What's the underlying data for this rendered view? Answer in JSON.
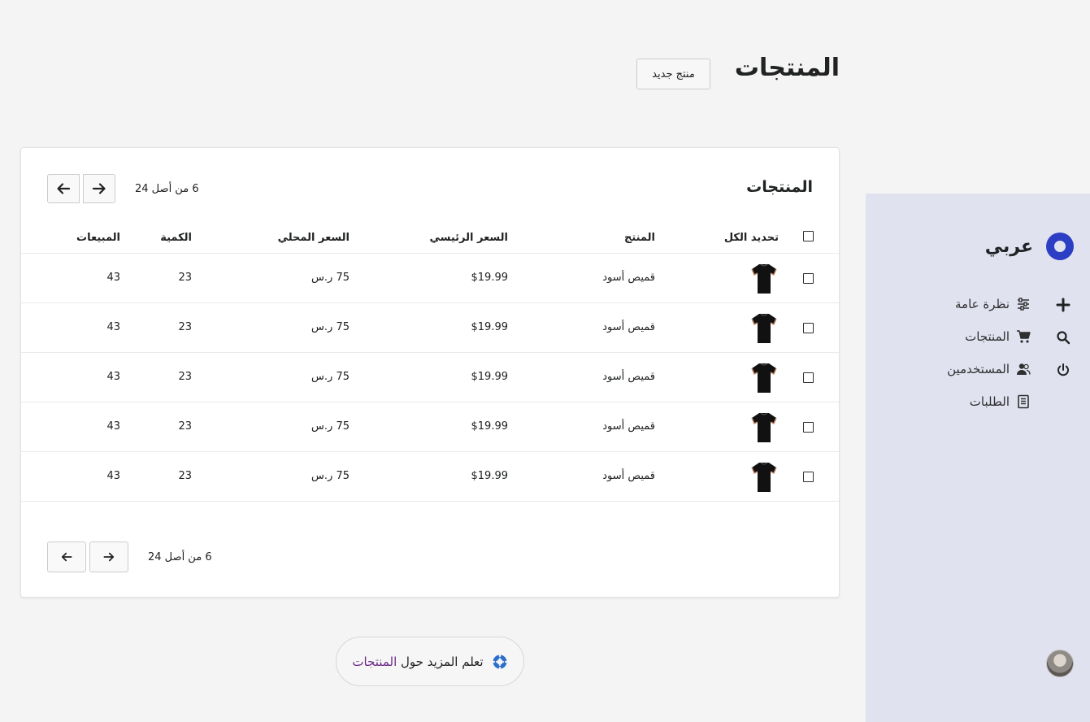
{
  "header": {
    "title": "المنتجات",
    "new_button_label": "منتج جديد"
  },
  "card": {
    "title": "المنتجات",
    "pagination_text": "6 من أصل 24",
    "columns": {
      "select_all": "تحديد الكل",
      "product": "المنتج",
      "base_price": "السعر الرئيسي",
      "local_price": "السعر المحلي",
      "quantity": "الكمية",
      "sales": "المبيعات"
    },
    "rows": [
      {
        "product": "قميص أسود",
        "base_price": "$19.99",
        "local_price": "75 ر.س",
        "quantity": "23",
        "sales": "43"
      },
      {
        "product": "قميص أسود",
        "base_price": "$19.99",
        "local_price": "75 ر.س",
        "quantity": "23",
        "sales": "43"
      },
      {
        "product": "قميص أسود",
        "base_price": "$19.99",
        "local_price": "75 ر.س",
        "quantity": "23",
        "sales": "43"
      },
      {
        "product": "قميص أسود",
        "base_price": "$19.99",
        "local_price": "75 ر.س",
        "quantity": "23",
        "sales": "43"
      },
      {
        "product": "قميص أسود",
        "base_price": "$19.99",
        "local_price": "75 ر.س",
        "quantity": "23",
        "sales": "43"
      }
    ]
  },
  "sidebar": {
    "brand": "عربي",
    "items": [
      {
        "label": "نظرة عامة",
        "icon": "sliders-icon"
      },
      {
        "label": "المنتجات",
        "icon": "cart-icon"
      },
      {
        "label": "المستخدمين",
        "icon": "users-icon"
      },
      {
        "label": "الطلبات",
        "icon": "orders-icon"
      }
    ],
    "rail": [
      "plus-icon",
      "search-icon",
      "power-icon"
    ]
  },
  "help": {
    "prefix": "تعلم المزيد حول ",
    "link": "المنتجات"
  },
  "colors": {
    "accent": "#2c3ec4",
    "sidebar_bg": "#e1e2f0",
    "link": "#6b2c84"
  }
}
